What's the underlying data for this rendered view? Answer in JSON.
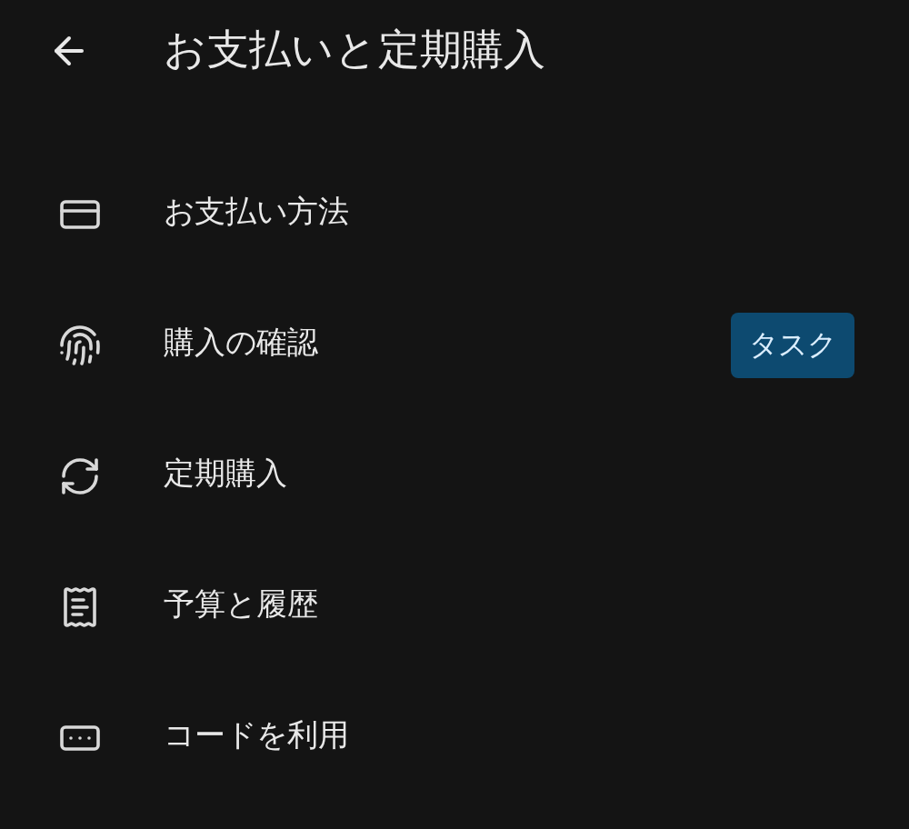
{
  "header": {
    "title": "お支払いと定期購入"
  },
  "items": [
    {
      "kind": "card",
      "label": "お支払い方法"
    },
    {
      "kind": "fingerprint",
      "label": "購入の確認",
      "badge": "タスク"
    },
    {
      "kind": "sync",
      "label": "定期購入"
    },
    {
      "kind": "receipt",
      "label": "予算と履歴"
    },
    {
      "kind": "code",
      "label": "コードを利用"
    }
  ]
}
